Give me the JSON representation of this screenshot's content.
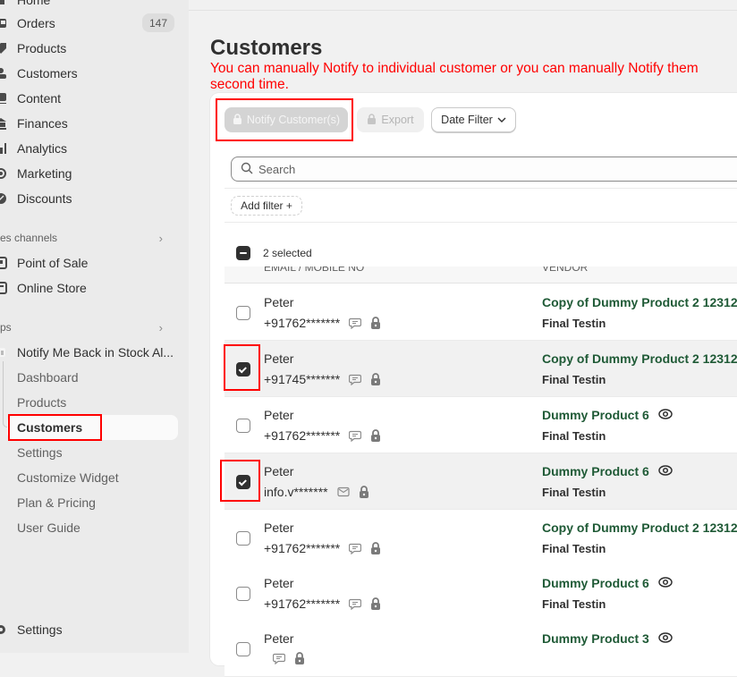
{
  "sidebar": {
    "main_items": [
      {
        "label": "Home",
        "icon": "home-icon"
      },
      {
        "label": "Orders",
        "icon": "orders-icon",
        "badge": "147"
      },
      {
        "label": "Products",
        "icon": "tag-icon"
      },
      {
        "label": "Customers",
        "icon": "person-icon"
      },
      {
        "label": "Content",
        "icon": "content-icon"
      },
      {
        "label": "Finances",
        "icon": "bank-icon"
      },
      {
        "label": "Analytics",
        "icon": "bar-chart-icon"
      },
      {
        "label": "Marketing",
        "icon": "target-icon"
      },
      {
        "label": "Discounts",
        "icon": "discount-icon"
      }
    ],
    "sales_channels_header": "es channels",
    "sales_channels": [
      {
        "label": "Point of Sale",
        "icon": "pos-icon"
      },
      {
        "label": "Online Store",
        "icon": "store-icon"
      }
    ],
    "apps_header": "ps",
    "app_name": "Notify Me Back in Stock Al...",
    "app_subitems": [
      {
        "label": "Dashboard"
      },
      {
        "label": "Products"
      },
      {
        "label": "Customers",
        "active": true
      },
      {
        "label": "Settings"
      },
      {
        "label": "Customize Widget"
      },
      {
        "label": "Plan & Pricing"
      },
      {
        "label": "User Guide"
      }
    ],
    "settings_label": "Settings"
  },
  "page": {
    "title": "Customers",
    "annotation": "You can manually Notify to individual customer or you can manually Notify them second time."
  },
  "toolbar": {
    "notify_label": "Notify Customer(s)",
    "export_label": "Export",
    "date_filter_label": "Date Filter"
  },
  "search": {
    "placeholder": "Search",
    "value": ""
  },
  "filters": {
    "add_filter_label": "Add filter +"
  },
  "table": {
    "selected_text": "2 selected",
    "columns": [
      "EMAIL / MOBILE NO",
      "VENDOR"
    ],
    "rows": [
      {
        "name": "Peter",
        "contact": "+91762*******",
        "contact_type": "sms",
        "product": "Copy of Dummy Product 2 12312",
        "product_eye": false,
        "vendor": "Final Testin",
        "selected": false
      },
      {
        "name": "Peter",
        "contact": "+91745*******",
        "contact_type": "sms",
        "product": "Copy of Dummy Product 2 12312",
        "product_eye": false,
        "vendor": "Final Testin",
        "selected": true
      },
      {
        "name": "Peter",
        "contact": "+91762*******",
        "contact_type": "sms",
        "product": "Dummy Product 6",
        "product_eye": true,
        "vendor": "Final Testin",
        "selected": false
      },
      {
        "name": "Peter",
        "contact": "info.v*******",
        "contact_type": "email",
        "product": "Dummy Product 6",
        "product_eye": true,
        "vendor": "Final Testin",
        "selected": true
      },
      {
        "name": "Peter",
        "contact": "+91762*******",
        "contact_type": "sms",
        "product": "Copy of Dummy Product 2 12312",
        "product_eye": false,
        "vendor": "Final Testin",
        "selected": false
      },
      {
        "name": "Peter",
        "contact": "+91762*******",
        "contact_type": "sms",
        "product": "Dummy Product 6",
        "product_eye": true,
        "vendor": "Final Testin",
        "selected": false
      },
      {
        "name": "Peter",
        "contact": "",
        "contact_type": "sms",
        "product": "Dummy Product 3",
        "product_eye": true,
        "vendor": "",
        "selected": false
      }
    ]
  },
  "colors": {
    "annotation_red": "#ff0000",
    "product_green": "#1f5a36",
    "sidebar_bg": "#ebebeb"
  }
}
